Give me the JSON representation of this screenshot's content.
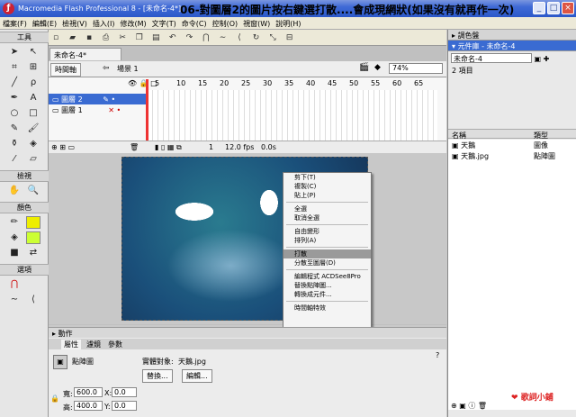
{
  "window": {
    "title": "Macromedia Flash Professional 8 - [未命名-4*]",
    "overlay_title": "06-對圖層2的圖片按右鍵選打散....會成現網狀(如果沒有就再作一次)"
  },
  "menu": [
    "檔案(F)",
    "編輯(E)",
    "檢視(V)",
    "插入(I)",
    "修改(M)",
    "文字(T)",
    "命令(C)",
    "控制(O)",
    "視窗(W)",
    "說明(H)"
  ],
  "tools": {
    "header": "工具",
    "view_label": "檢視",
    "color_label": "顏色",
    "options_label": "選項"
  },
  "document": {
    "tab": "未命名-4*",
    "timeline_button": "時間軸",
    "scene": "場景 1",
    "zoom": "74%"
  },
  "timeline": {
    "layers": [
      {
        "name": "圖層 2"
      },
      {
        "name": "圖層 1"
      }
    ],
    "frame_ticks": [
      "5",
      "10",
      "15",
      "20",
      "25",
      "30",
      "35",
      "40",
      "45",
      "50",
      "55",
      "60",
      "65"
    ],
    "current_frame": "1",
    "fps": "12.0 fps",
    "time": "0.0s"
  },
  "context_menu": {
    "items": [
      "剪下(T)",
      "複製(C)",
      "貼上(P)",
      "全選",
      "取消全選",
      "自由變形",
      "排列(A)",
      "打散",
      "分散至圖層(D)",
      "編輯程式 ACDSee8Pro",
      "替換點陣圖...",
      "轉換成元件...",
      "時間軸特效"
    ],
    "highlighted_index": 7
  },
  "properties": {
    "collapsed_panel": "動作",
    "tabs": [
      "屬性",
      "濾鏡",
      "參數"
    ],
    "type_label": "點陣圖",
    "instance_label": "實體對象:",
    "instance_value": "天鵝.jpg",
    "swap_button": "替換...",
    "edit_button": "編輯...",
    "w_label": "寬:",
    "w_value": "600.0",
    "h_label": "高:",
    "h_value": "400.0",
    "x_label": "X:",
    "x_value": "0.0",
    "y_label": "Y:",
    "y_value": "0.0"
  },
  "right_panel": {
    "color_panel": "調色盤",
    "library_title": "元件庫 - 未命名-4",
    "library_doc": "未命名-4",
    "item_count": "2 項目",
    "col_name": "名稱",
    "col_type": "類型",
    "items": [
      {
        "name": "天鵝",
        "type": "圖像"
      },
      {
        "name": "天鵝.jpg",
        "type": "點陣圖"
      }
    ]
  },
  "watermark": "歌詞小鋪"
}
